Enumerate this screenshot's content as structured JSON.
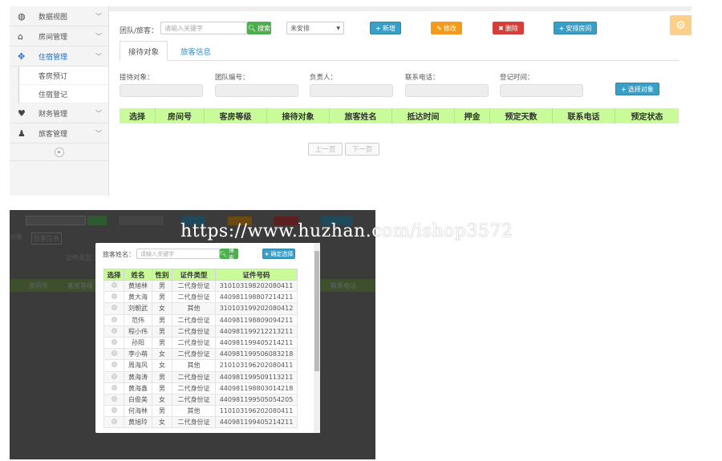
{
  "sidebar": {
    "items": [
      {
        "label": "数据视图",
        "icon": "dashboard-icon"
      },
      {
        "label": "房间管理",
        "icon": "home-icon"
      },
      {
        "label": "住宿管理",
        "icon": "move-icon"
      },
      {
        "label": "财务管理",
        "icon": "heart-icon"
      },
      {
        "label": "旅客管理",
        "icon": "user-icon"
      }
    ],
    "sub_items": [
      "客房预订",
      "住宿登记"
    ],
    "collapse": "«"
  },
  "toolbar": {
    "search_label": "团队/旅客：",
    "search_placeholder": "请输入关键字",
    "search_btn": "搜索",
    "status_select": "未安排",
    "add": "新增",
    "edit": "修改",
    "delete": "删除",
    "arrange": "安排房间"
  },
  "tabs": [
    "接待对象",
    "旅客信息"
  ],
  "form": {
    "labels": [
      "接待对象：",
      "团队编号：",
      "负责人：",
      "联系电话：",
      "登记时间："
    ],
    "select_btn": "选择对象"
  },
  "table": {
    "headers": [
      "选择",
      "房间号",
      "客房等级",
      "接待对象",
      "旅客姓名",
      "抵达时间",
      "押金",
      "预定天数",
      "联系电话",
      "预定状态"
    ]
  },
  "pager": {
    "prev": "上一页",
    "next": "下一页"
  },
  "background2": {
    "doc_type_label": "证件类型：",
    "headers": [
      "房间号",
      "客房等级",
      "联系电话"
    ],
    "tab1": "对象"
  },
  "modal": {
    "label": "旅客姓名：",
    "placeholder": "请输入关键字",
    "search_btn": "搜索",
    "confirm_btn": "确定选择",
    "headers": [
      "选择",
      "姓名",
      "性别",
      "证件类型",
      "证件号码"
    ],
    "rows": [
      [
        "黄旭林",
        "男",
        "二代身份证",
        "310103198202080411"
      ],
      [
        "黄大海",
        "男",
        "二代身份证",
        "440981198807214211"
      ],
      [
        "刘朝武",
        "女",
        "其他",
        "310103199202080412"
      ],
      [
        "范伟",
        "男",
        "二代身份证",
        "440981198809094211"
      ],
      [
        "程小伟",
        "男",
        "二代身份证",
        "440981199212213211"
      ],
      [
        "孙阳",
        "男",
        "二代身份证",
        "440981199405214211"
      ],
      [
        "李小萌",
        "女",
        "二代身份证",
        "440981199506083218"
      ],
      [
        "周海风",
        "女",
        "其他",
        "210103196202080411"
      ],
      [
        "黄海涛",
        "男",
        "二代身份证",
        "440981199509113211"
      ],
      [
        "黄海鑫",
        "男",
        "二代身份证",
        "440981198803014218"
      ],
      [
        "白俊美",
        "女",
        "二代身份证",
        "440981199505054205"
      ],
      [
        "何海林",
        "男",
        "其他",
        "110103196202080411"
      ],
      [
        "黄旭玲",
        "女",
        "二代身份证",
        "440981199405214211"
      ]
    ]
  },
  "watermark": "https://www.huzhan.com/ishop3572"
}
